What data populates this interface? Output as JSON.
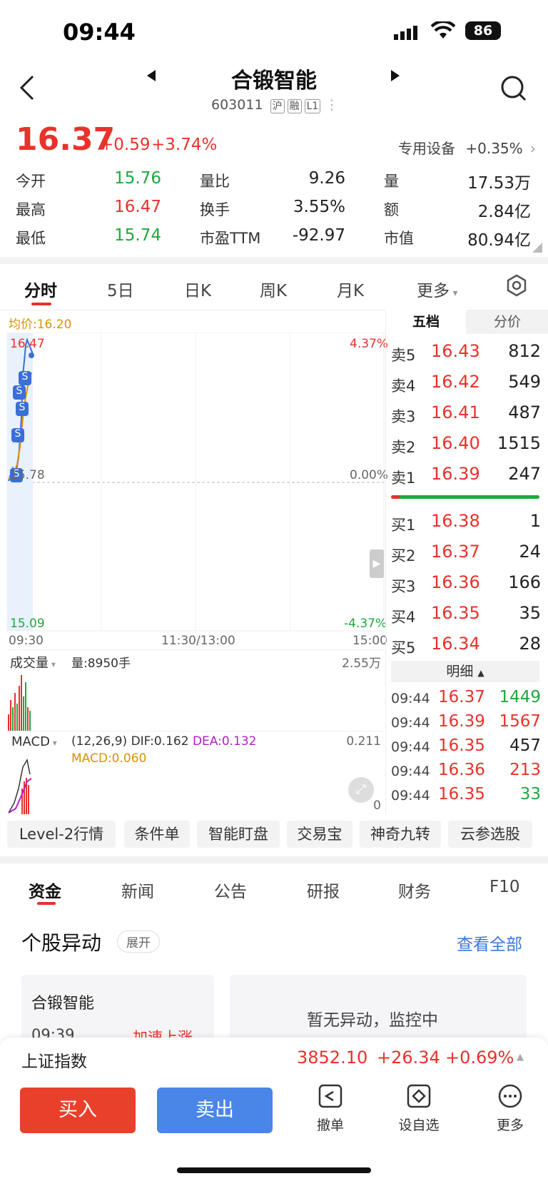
{
  "status_bar": {
    "time": "09:44",
    "battery": "86"
  },
  "header": {
    "title": "合锻智能",
    "code": "603011",
    "tags": [
      "沪",
      "融",
      "L1"
    ]
  },
  "quote": {
    "price": "16.37",
    "change": "+0.59",
    "change_pct": "+3.74%",
    "sector": "专用设备",
    "sector_change": "+0.35%"
  },
  "stats": [
    {
      "label": "今开",
      "value": "15.76",
      "color": "green"
    },
    {
      "label": "量比",
      "value": "9.26",
      "color": "black"
    },
    {
      "label": "量",
      "value": "17.53万",
      "color": "black"
    },
    {
      "label": "最高",
      "value": "16.47",
      "color": "red"
    },
    {
      "label": "换手",
      "value": "3.55%",
      "color": "black"
    },
    {
      "label": "额",
      "value": "2.84亿",
      "color": "black"
    },
    {
      "label": "最低",
      "value": "15.74",
      "color": "green"
    },
    {
      "label": "市盈TTM",
      "value": "-92.97",
      "color": "black"
    },
    {
      "label": "市值",
      "value": "80.94亿",
      "color": "black"
    }
  ],
  "chart_tabs": [
    "分时",
    "5日",
    "日K",
    "周K",
    "月K",
    "更多"
  ],
  "chart": {
    "avg_price": "均价:16.20",
    "y_top": "16.47",
    "y_mid": "15.78",
    "y_bottom": "15.09",
    "pct_top": "4.37%",
    "pct_mid": "0.00%",
    "pct_bottom": "-4.37%",
    "x_labels": [
      "09:30",
      "11:30/13:00",
      "15:00"
    ],
    "signal": "S"
  },
  "volume": {
    "label": "成交量",
    "amount": "量:8950手",
    "max": "2.55万"
  },
  "macd": {
    "label": "MACD",
    "params": "(12,26,9)",
    "dif": "DIF:0.162",
    "dea": "DEA:0.132",
    "macd": "MACD:0.060",
    "max": "0.211",
    "zero": "0"
  },
  "order_book": {
    "tabs": [
      "五档",
      "分价"
    ],
    "asks": [
      {
        "label": "卖5",
        "price": "16.43",
        "vol": "812"
      },
      {
        "label": "卖4",
        "price": "16.42",
        "vol": "549"
      },
      {
        "label": "卖3",
        "price": "16.41",
        "vol": "487"
      },
      {
        "label": "卖2",
        "price": "16.40",
        "vol": "1515"
      },
      {
        "label": "卖1",
        "price": "16.39",
        "vol": "247"
      }
    ],
    "bids": [
      {
        "label": "买1",
        "price": "16.38",
        "vol": "1"
      },
      {
        "label": "买2",
        "price": "16.37",
        "vol": "24"
      },
      {
        "label": "买3",
        "price": "16.36",
        "vol": "166"
      },
      {
        "label": "买4",
        "price": "16.35",
        "vol": "35"
      },
      {
        "label": "买5",
        "price": "16.34",
        "vol": "28"
      }
    ],
    "detail_label": "明细",
    "trades": [
      {
        "time": "09:44",
        "price": "16.37",
        "vol": "1449",
        "color": "green"
      },
      {
        "time": "09:44",
        "price": "16.39",
        "vol": "1567",
        "color": "red"
      },
      {
        "time": "09:44",
        "price": "16.35",
        "vol": "457",
        "color": "black"
      },
      {
        "time": "09:44",
        "price": "16.36",
        "vol": "213",
        "color": "red"
      },
      {
        "time": "09:44",
        "price": "16.35",
        "vol": "33",
        "color": "green"
      }
    ]
  },
  "tools": [
    "Level-2行情",
    "条件单",
    "智能盯盘",
    "交易宝",
    "神奇九转",
    "云参选股"
  ],
  "bottom_tabs": [
    "资金",
    "新闻",
    "公告",
    "研报",
    "财务",
    "F10"
  ],
  "movement": {
    "title": "个股异动",
    "expand": "展开",
    "view_all": "查看全部",
    "card_name": "合锻智能",
    "card_time": "09:39",
    "card_event": "加速上涨",
    "empty_text": "暂无异动，监控中"
  },
  "index_bar": {
    "name": "上证指数",
    "value": "3852.10",
    "change": "+26.34",
    "pct": "+0.69%"
  },
  "actions": {
    "buy": "买入",
    "sell": "卖出",
    "cancel": "撤单",
    "watch": "设自选",
    "more": "更多"
  }
}
